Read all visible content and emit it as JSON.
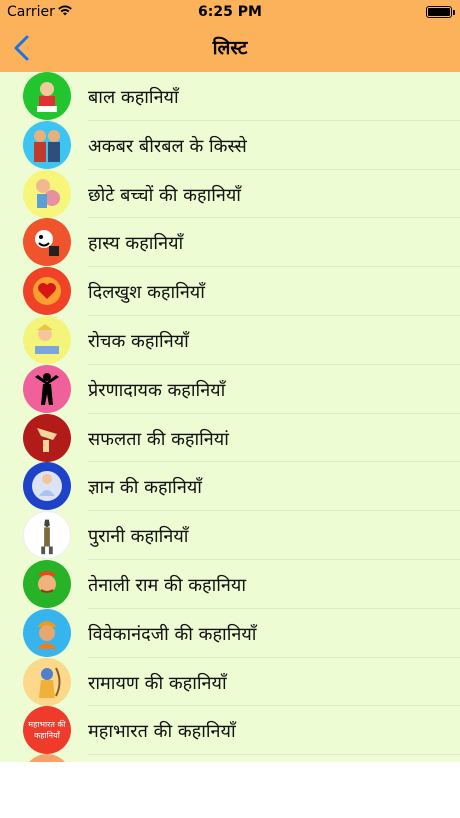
{
  "status_bar": {
    "carrier": "Carrier",
    "time": "6:25 PM"
  },
  "header": {
    "title": "लिस्ट"
  },
  "items": [
    {
      "label": "बाल कहानियाँ",
      "icon": "child-reading-icon",
      "color": "#22c52e"
    },
    {
      "label": "अकबर बीरबल के किस्से",
      "icon": "akbar-birbal-icon",
      "color": "#3ec4f0"
    },
    {
      "label": "छोटे बच्चों की कहानियाँ",
      "icon": "kids-icon",
      "color": "#f7f57a"
    },
    {
      "label": "हास्य कहानियाँ",
      "icon": "funny-face-icon",
      "color": "#f0542c"
    },
    {
      "label": "दिलखुश कहानियाँ",
      "icon": "heart-icon",
      "color": "#f04226"
    },
    {
      "label": "रोचक कहानियाँ",
      "icon": "student-icon",
      "color": "#f4f47a"
    },
    {
      "label": "प्रेरणादायक कहानियाँ",
      "icon": "person-silhouette-icon",
      "color": "#f0609a"
    },
    {
      "label": "सफलता की कहानियां",
      "icon": "trophy-icon",
      "color": "#b31b1b"
    },
    {
      "label": "ज्ञान की कहानियाँ",
      "icon": "meditation-icon",
      "color": "#1f43c8"
    },
    {
      "label": "पुरानी कहानियाँ",
      "icon": "anubis-icon",
      "color": "#ffffff"
    },
    {
      "label": "तेनाली राम की कहानिया",
      "icon": "tenali-icon",
      "color": "#27b227"
    },
    {
      "label": "विवेकानंदजी की कहानियाँ",
      "icon": "vivekananda-icon",
      "color": "#36b4ee"
    },
    {
      "label": "रामायण की कहानियाँ",
      "icon": "rama-icon",
      "color": "#fbd88a"
    },
    {
      "label": "महाभारत की कहानियाँ",
      "icon": "mahabharat-icon",
      "color": "#ee3b2b",
      "icon_text": "महाभारत की कहानियाँ"
    }
  ]
}
